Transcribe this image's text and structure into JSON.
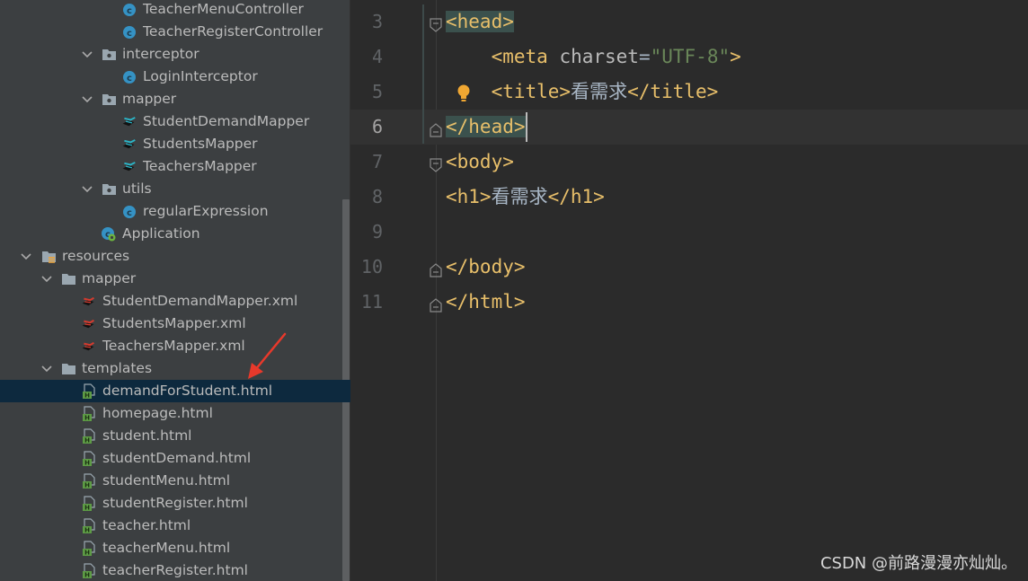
{
  "tree": {
    "items": [
      {
        "label": "TeacherMenuController",
        "icon": "class-icon"
      },
      {
        "label": "TeacherRegisterController",
        "icon": "class-icon"
      },
      {
        "label": "interceptor",
        "icon": "package-folder-icon",
        "expanded": true
      },
      {
        "label": "LoginInterceptor",
        "icon": "class-icon"
      },
      {
        "label": "mapper",
        "icon": "package-folder-icon",
        "expanded": true
      },
      {
        "label": "StudentDemandMapper",
        "icon": "mybatis-mapper-icon"
      },
      {
        "label": "StudentsMapper",
        "icon": "mybatis-mapper-icon"
      },
      {
        "label": "TeachersMapper",
        "icon": "mybatis-mapper-icon"
      },
      {
        "label": "utils",
        "icon": "package-folder-icon",
        "expanded": true
      },
      {
        "label": "regularExpression",
        "icon": "class-icon"
      },
      {
        "label": "Application",
        "icon": "spring-boot-class-icon"
      },
      {
        "label": "resources",
        "icon": "resources-folder-icon",
        "expanded": true
      },
      {
        "label": "mapper",
        "icon": "folder-icon",
        "expanded": true
      },
      {
        "label": "StudentDemandMapper.xml",
        "icon": "mybatis-xml-icon"
      },
      {
        "label": "StudentsMapper.xml",
        "icon": "mybatis-xml-icon"
      },
      {
        "label": "TeachersMapper.xml",
        "icon": "mybatis-xml-icon"
      },
      {
        "label": "templates",
        "icon": "folder-icon",
        "expanded": true
      },
      {
        "label": "demandForStudent.html",
        "icon": "html-file-icon",
        "selected": true
      },
      {
        "label": "homepage.html",
        "icon": "html-file-icon"
      },
      {
        "label": "student.html",
        "icon": "html-file-icon"
      },
      {
        "label": "studentDemand.html",
        "icon": "html-file-icon"
      },
      {
        "label": "studentMenu.html",
        "icon": "html-file-icon"
      },
      {
        "label": "studentRegister.html",
        "icon": "html-file-icon"
      },
      {
        "label": "teacher.html",
        "icon": "html-file-icon"
      },
      {
        "label": "teacherMenu.html",
        "icon": "html-file-icon"
      },
      {
        "label": "teacherRegister.html",
        "icon": "html-file-icon"
      }
    ]
  },
  "editor": {
    "current_line": "6",
    "lines": [
      {
        "num": "3",
        "tokens": [
          {
            "t": "<head>",
            "c": "tag",
            "hl": true
          }
        ],
        "fold": "start"
      },
      {
        "num": "4",
        "tokens": [
          {
            "t": "    ",
            "c": "indent"
          },
          {
            "t": "<meta ",
            "c": "tag"
          },
          {
            "t": "charset",
            "c": "attr"
          },
          {
            "t": "=",
            "c": "txt"
          },
          {
            "t": "\"UTF-8\"",
            "c": "str"
          },
          {
            "t": ">",
            "c": "tag"
          }
        ]
      },
      {
        "num": "5",
        "tokens": [
          {
            "t": "    ",
            "c": "indent"
          },
          {
            "t": "<title>",
            "c": "tag"
          },
          {
            "t": "看需求",
            "c": "txt"
          },
          {
            "t": "</title>",
            "c": "tag"
          }
        ],
        "bulb": true
      },
      {
        "num": "6",
        "tokens": [
          {
            "t": "</head>",
            "c": "tag",
            "hl": true
          }
        ],
        "fold": "end",
        "current": true
      },
      {
        "num": "7",
        "tokens": [
          {
            "t": "<body>",
            "c": "tag"
          }
        ],
        "fold": "start"
      },
      {
        "num": "8",
        "tokens": [
          {
            "t": "<h1>",
            "c": "tag"
          },
          {
            "t": "看需求",
            "c": "txt"
          },
          {
            "t": "</h1>",
            "c": "tag"
          }
        ]
      },
      {
        "num": "9",
        "tokens": []
      },
      {
        "num": "10",
        "tokens": [
          {
            "t": "</body>",
            "c": "tag"
          }
        ],
        "fold": "end"
      },
      {
        "num": "11",
        "tokens": [
          {
            "t": "</html>",
            "c": "tag"
          }
        ],
        "fold": "end"
      }
    ]
  },
  "watermark": "CSDN @前路漫漫亦灿灿。",
  "colors": {
    "tree_bg": "#3c3f41",
    "editor_bg": "#2b2b2b",
    "selection": "#0d293e",
    "tag": "#e8bf6a",
    "string": "#6a8759",
    "arrow": "#e8392b"
  }
}
